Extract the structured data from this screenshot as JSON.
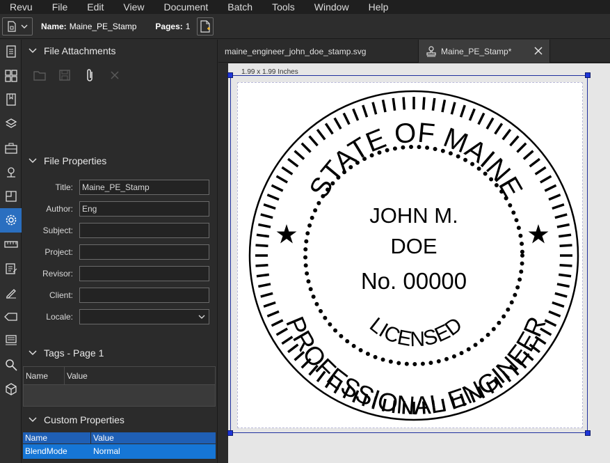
{
  "menu": [
    "Revu",
    "File",
    "Edit",
    "View",
    "Document",
    "Batch",
    "Tools",
    "Window",
    "Help"
  ],
  "toolbar": {
    "name_label": "Name:",
    "name_value": "Maine_PE_Stamp",
    "pages_label": "Pages:",
    "pages_value": "1"
  },
  "iconbar": [
    "thumbnails-icon",
    "layout-icon",
    "bookmarks-icon",
    "layers-icon",
    "toolchest-icon",
    "places-icon",
    "spaces-icon",
    "properties-icon",
    "measurements-icon",
    "markups-icon",
    "signatures-icon",
    "tags-icon",
    "stamp-icon",
    "search-icon",
    "3d-icon"
  ],
  "file_attachments": {
    "title": "File Attachments"
  },
  "file_properties": {
    "title": "File Properties",
    "fields": [
      {
        "label": "Title:",
        "value": "Maine_PE_Stamp"
      },
      {
        "label": "Author:",
        "value": "Eng"
      },
      {
        "label": "Subject:",
        "value": ""
      },
      {
        "label": "Project:",
        "value": ""
      },
      {
        "label": "Revisor:",
        "value": ""
      },
      {
        "label": "Client:",
        "value": ""
      }
    ],
    "locale_label": "Locale:",
    "locale_value": ""
  },
  "tags": {
    "title": "Tags - Page 1",
    "col_name": "Name",
    "col_value": "Value"
  },
  "custom_properties": {
    "title": "Custom Properties",
    "col_name": "Name",
    "col_value": "Value",
    "rows": [
      {
        "name": "BlendMode",
        "value": "Normal"
      }
    ]
  },
  "tabs": [
    {
      "label": "maine_engineer_john_doe_stamp.svg"
    },
    {
      "label": "Maine_PE_Stamp*"
    }
  ],
  "canvas": {
    "dimensions": "1.99 x 1.99 Inches"
  },
  "stamp": {
    "top_arc": "STATE OF MAINE",
    "bottom_arc": "PROFESSIONAL ENGINEER",
    "name_line1": "JOHN M.",
    "name_line2": "DOE",
    "number": "No. 00000",
    "licensed": "LICENSED"
  },
  "colors": {
    "accent": "#1676d6",
    "selection_handle": "#1e35d8",
    "panel_bg": "#2b2b2b"
  }
}
